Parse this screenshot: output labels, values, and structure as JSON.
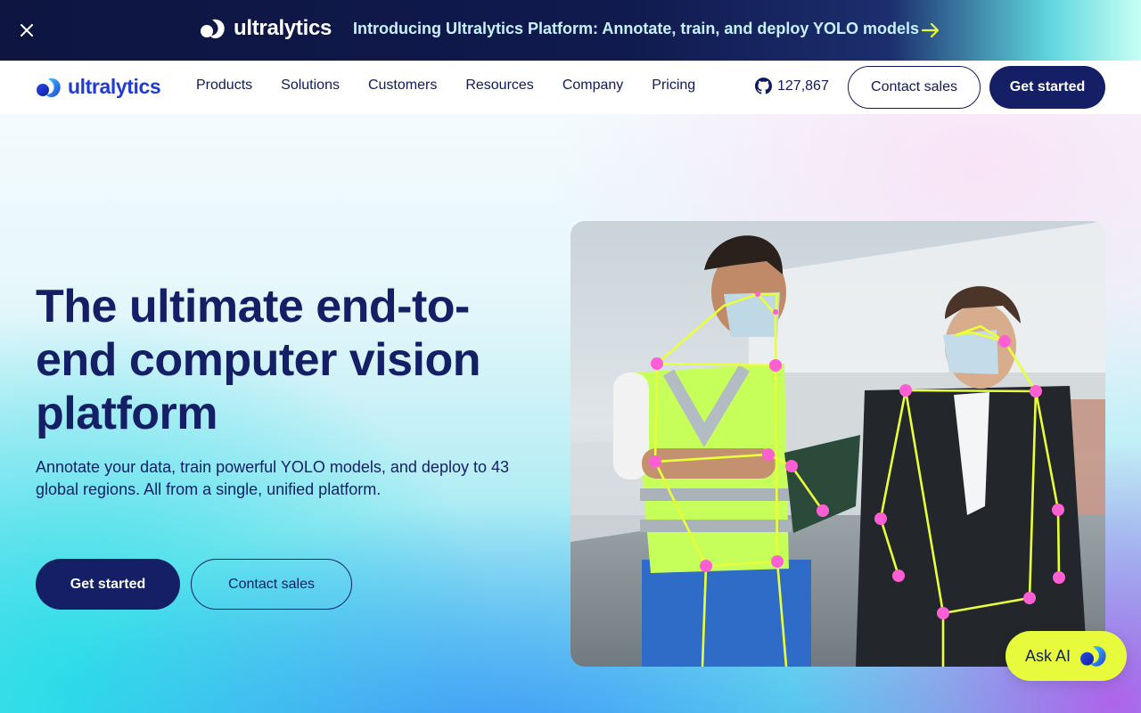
{
  "banner": {
    "brand": "ultralytics",
    "text": "Introducing Ultralytics Platform: Annotate, train, and deploy YOLO models",
    "close_icon": "close-icon",
    "arrow_icon": "arrow-right-icon"
  },
  "navbar": {
    "brand": "ultralytics",
    "links": [
      "Products",
      "Solutions",
      "Customers",
      "Resources",
      "Company",
      "Pricing"
    ],
    "github_stars": "127,867",
    "contact_label": "Contact sales",
    "get_started_label": "Get started"
  },
  "hero": {
    "title": "The ultimate end-to-end computer vision platform",
    "subtitle": "Annotate your data, train powerful YOLO models, and deploy to 43 global regions. All from a single, unified platform.",
    "primary_cta": "Get started",
    "secondary_cta": "Contact sales",
    "image_alt_icon": "pose-estimation-photo"
  },
  "ask_ai": {
    "label": "Ask AI"
  },
  "colors": {
    "navy": "#141f66",
    "brand_blue": "#1f3bd1",
    "lime": "#e7fb3c",
    "keypoint": "#ff5fd2",
    "skeleton": "#e9ff3a"
  }
}
